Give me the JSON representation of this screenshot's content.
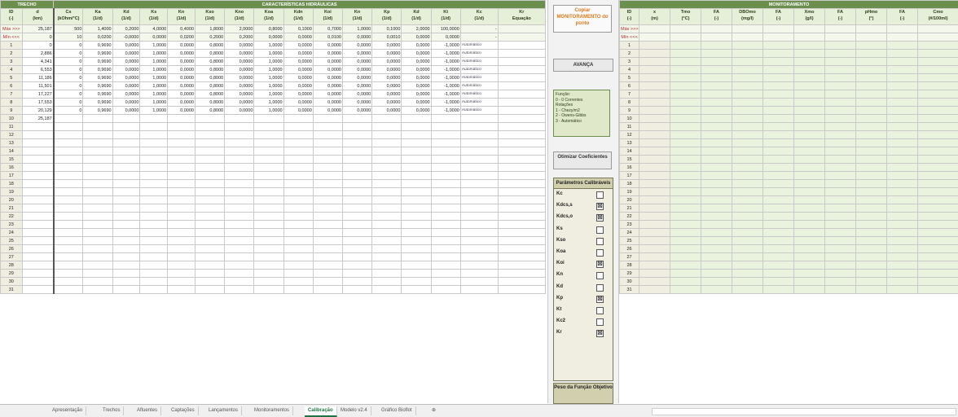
{
  "left": {
    "group_trechos": "TRECHO",
    "group_caracteristicas": "CARACTERÍSTICAS HIDRÁULICAS",
    "headers": [
      [
        "ID",
        "(-)"
      ],
      [
        "d",
        "(km)"
      ],
      [
        "Cs",
        "(kOhm/°C)"
      ],
      [
        "Ka",
        "(1/d)"
      ],
      [
        "Kd",
        "(1/d)"
      ],
      [
        "Ks",
        "(1/d)"
      ],
      [
        "Kn",
        "(1/d)"
      ],
      [
        "Kso",
        "(1/d)"
      ],
      [
        "Kno",
        "(1/d)"
      ],
      [
        "Koa",
        "(1/d)"
      ],
      [
        "Kdn",
        "(1/d)"
      ],
      [
        "Koi",
        "(1/d)"
      ],
      [
        "Kn",
        "(1/d)"
      ],
      [
        "Kp",
        "(1/d)"
      ],
      [
        "Kd",
        "(1/d)"
      ],
      [
        "Kt",
        "(1/d)"
      ],
      [
        "Kc",
        "(1/d)"
      ],
      [
        "Kr",
        "Equação"
      ]
    ],
    "max_row": [
      "Máx >>>",
      "25,187",
      "500",
      "1,4000",
      "0,2000",
      "4,0000",
      "0,4000",
      "1,8000",
      "2,0000",
      "0,8000",
      "0,1000",
      "0,7000",
      "1,0000",
      "0,1000",
      "2,0000",
      "100,0000",
      "-"
    ],
    "min_row": [
      "Mín <<<",
      "0",
      "10",
      "0,0200",
      "-0,0000",
      "0,0000",
      "0,0200",
      "0,2000",
      "0,2000",
      "0,0000",
      "0,0000",
      "0,0100",
      "0,0000",
      "0,0010",
      "0,0000",
      "0,0000",
      "-"
    ],
    "rows": [
      [
        "1",
        "0",
        "0",
        "0,9690",
        "0,0000",
        "1,0000",
        "0,0000",
        "0,8000",
        "0,0000",
        "1,0000",
        "0,0000",
        "0,0000",
        "0,0000",
        "0,0000",
        "0,0000",
        "-1,0000",
        "Automático"
      ],
      [
        "2",
        "2,886",
        "0",
        "0,9690",
        "0,0000",
        "1,0000",
        "0,0000",
        "0,8000",
        "0,0000",
        "1,0000",
        "0,0000",
        "0,0000",
        "0,0000",
        "0,0000",
        "0,0000",
        "-1,0000",
        "Automático"
      ],
      [
        "3",
        "4,341",
        "0",
        "0,9690",
        "0,0000",
        "1,0000",
        "0,0000",
        "0,8000",
        "0,0000",
        "1,0000",
        "0,0000",
        "0,0000",
        "0,0000",
        "0,0000",
        "0,0000",
        "-1,0000",
        "Automático"
      ],
      [
        "4",
        "6,553",
        "0",
        "0,9690",
        "0,0000",
        "1,0000",
        "0,0000",
        "0,8000",
        "0,0000",
        "1,0000",
        "0,0000",
        "0,0000",
        "0,0000",
        "0,0000",
        "0,0000",
        "-1,0000",
        "Automático"
      ],
      [
        "5",
        "11,186",
        "0",
        "0,9690",
        "0,0000",
        "1,0000",
        "0,0000",
        "0,8000",
        "0,0000",
        "1,0000",
        "0,0000",
        "0,0000",
        "0,0000",
        "0,0000",
        "0,0000",
        "-1,0000",
        "Automático"
      ],
      [
        "6",
        "11,501",
        "0",
        "0,9690",
        "0,0000",
        "1,0000",
        "0,0000",
        "0,8000",
        "0,0000",
        "1,0000",
        "0,0000",
        "0,0000",
        "0,0000",
        "0,0000",
        "0,0000",
        "-1,0000",
        "Automático"
      ],
      [
        "7",
        "17,227",
        "0",
        "0,9690",
        "0,0000",
        "1,0000",
        "0,0000",
        "0,8000",
        "0,0000",
        "1,0000",
        "0,0000",
        "0,0000",
        "0,0000",
        "0,0000",
        "0,0000",
        "-1,0000",
        "Automático"
      ],
      [
        "8",
        "17,553",
        "0",
        "0,9690",
        "0,0000",
        "1,0000",
        "0,0000",
        "0,8000",
        "0,0000",
        "1,0000",
        "0,0000",
        "0,0000",
        "0,0000",
        "0,0000",
        "0,0000",
        "-1,0000",
        "Automático"
      ],
      [
        "9",
        "20,129",
        "0",
        "0,9690",
        "0,0000",
        "1,0000",
        "0,0000",
        "0,8000",
        "0,0000",
        "1,0000",
        "0,0000",
        "0,0000",
        "0,0000",
        "0,0000",
        "0,0000",
        "-1,0000",
        "Automático"
      ],
      [
        "10",
        "25,187",
        "",
        "",
        "",
        "",
        "",
        "",
        "",
        "",
        "",
        "",
        "",
        "",
        "",
        "",
        ""
      ]
    ],
    "empty_ids": [
      "11",
      "12",
      "13",
      "14",
      "15",
      "16",
      "17",
      "18",
      "19",
      "20",
      "21",
      "22",
      "23",
      "24",
      "25",
      "26",
      "27",
      "28",
      "29",
      "30",
      "31"
    ]
  },
  "panel": {
    "copy_button": "Copiar MONITORAMENTO do ponto",
    "avancar_button": "AVANÇA",
    "legend_text": "Função:\n0 - 0 Correntes\nRotações\n1 - Chezy/m2\n2 - Owens-Gibbs\n3 - Automático",
    "otimizar_button": "Otimizar Coeficientes",
    "params_title": "Parâmetros Calibráveis",
    "params": [
      {
        "label": "Kc",
        "checked": false
      },
      {
        "label": "Kdcs,s",
        "checked": true
      },
      {
        "label": "Kdcs,o",
        "checked": true
      },
      {
        "label": "Ks",
        "checked": false
      },
      {
        "label": "Kso",
        "checked": false
      },
      {
        "label": "Koa",
        "checked": false
      },
      {
        "label": "Koi",
        "checked": true
      },
      {
        "label": "Kn",
        "checked": false
      },
      {
        "label": "Kd",
        "checked": false
      },
      {
        "label": "Kp",
        "checked": true
      },
      {
        "label": "Kt",
        "checked": false
      },
      {
        "label": "Kc2",
        "checked": false
      },
      {
        "label": "Kr",
        "checked": true
      }
    ],
    "peso_label": "Peso da Função Objetivo"
  },
  "right": {
    "group_title": "MONITORAMENTO",
    "headers": [
      [
        "ID",
        "(-)"
      ],
      [
        "x",
        "(m)"
      ],
      [
        "Tmo",
        "(°C)"
      ],
      [
        "FA",
        "(-)"
      ],
      [
        "DBOmo",
        "(mg/l)"
      ],
      [
        "FA",
        "(-)"
      ],
      [
        "Xmo",
        "(g/l)"
      ],
      [
        "FA",
        "(-)"
      ],
      [
        "pHmo",
        "(°)"
      ],
      [
        "FA",
        "(-)"
      ],
      [
        "Cmo",
        "(#/100ml)"
      ]
    ],
    "max_label": "Máx >>>",
    "min_label": "Mín <<<",
    "ids": [
      "1",
      "2",
      "3",
      "4",
      "5",
      "6",
      "7",
      "8",
      "9",
      "10",
      "11",
      "12",
      "13",
      "14",
      "15",
      "16",
      "17",
      "18",
      "19",
      "20",
      "21",
      "22",
      "23",
      "24",
      "25",
      "26",
      "27",
      "28",
      "29",
      "30",
      "31"
    ]
  },
  "tabs": [
    "Apresentação",
    "Trechos",
    "Afluentes",
    "Captações",
    "Lançamentos",
    "Monitoramentos",
    "Calibração",
    "Modelo v2.4",
    "Gráfico Bioflot"
  ],
  "active_tab": "Calibração",
  "tab_add": "⊕"
}
